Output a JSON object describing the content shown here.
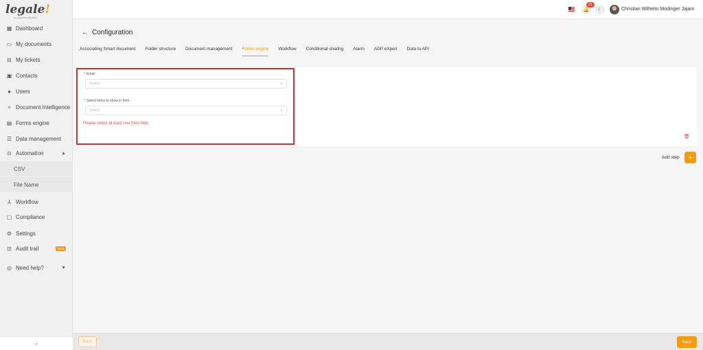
{
  "app": {
    "logo_text": "legale",
    "logo_bang": "!",
    "logo_sub": "by stepstoneNation"
  },
  "sidebar": {
    "items": [
      {
        "label": "Dashboard",
        "icon": "dashboard-icon"
      },
      {
        "label": "My documents",
        "icon": "folder-icon"
      },
      {
        "label": "My tickets",
        "icon": "ticket-icon"
      },
      {
        "label": "Contacts",
        "icon": "contacts-icon"
      },
      {
        "label": "Users",
        "icon": "user-icon"
      },
      {
        "label": "Document Intelligence",
        "icon": "sparkle-icon"
      },
      {
        "label": "Forms engine",
        "icon": "form-icon"
      },
      {
        "label": "Data management",
        "icon": "database-icon"
      },
      {
        "label": "Automation",
        "icon": "automation-icon"
      },
      {
        "label": "Workflow",
        "icon": "workflow-icon"
      },
      {
        "label": "Compliance",
        "icon": "compliance-icon"
      },
      {
        "label": "Settings",
        "icon": "gear-icon"
      },
      {
        "label": "Audit trail",
        "icon": "audit-icon"
      },
      {
        "label": "Need help?",
        "icon": "help-icon"
      }
    ],
    "automation_sub": [
      "CSV",
      "File Name"
    ],
    "new_badge": "NEW",
    "collapse_label": "‹"
  },
  "topbar": {
    "notification_count": "21",
    "user_name": "Christian Wilhelm Modinger Jajam"
  },
  "page": {
    "title": "Configuration",
    "tabs": [
      "Associating Smart document",
      "Folder structure",
      "Document management",
      "Forms engine",
      "Workflow",
      "Conditional sharing",
      "Alarm",
      "ADP eXpert",
      "Data to API"
    ],
    "active_tab": "Forms engine"
  },
  "form": {
    "email_label": "Email",
    "email_placeholder": "Select",
    "items_label": "Select items to show in form",
    "items_placeholder": "Select",
    "error": "Please select at least one form field."
  },
  "actions": {
    "add_step": "Add step",
    "add_symbol": "+",
    "back": "Back",
    "save": "Save"
  },
  "colors": {
    "accent": "#f39c12",
    "error": "#e74c3c",
    "highlight": "#d32f2f"
  }
}
